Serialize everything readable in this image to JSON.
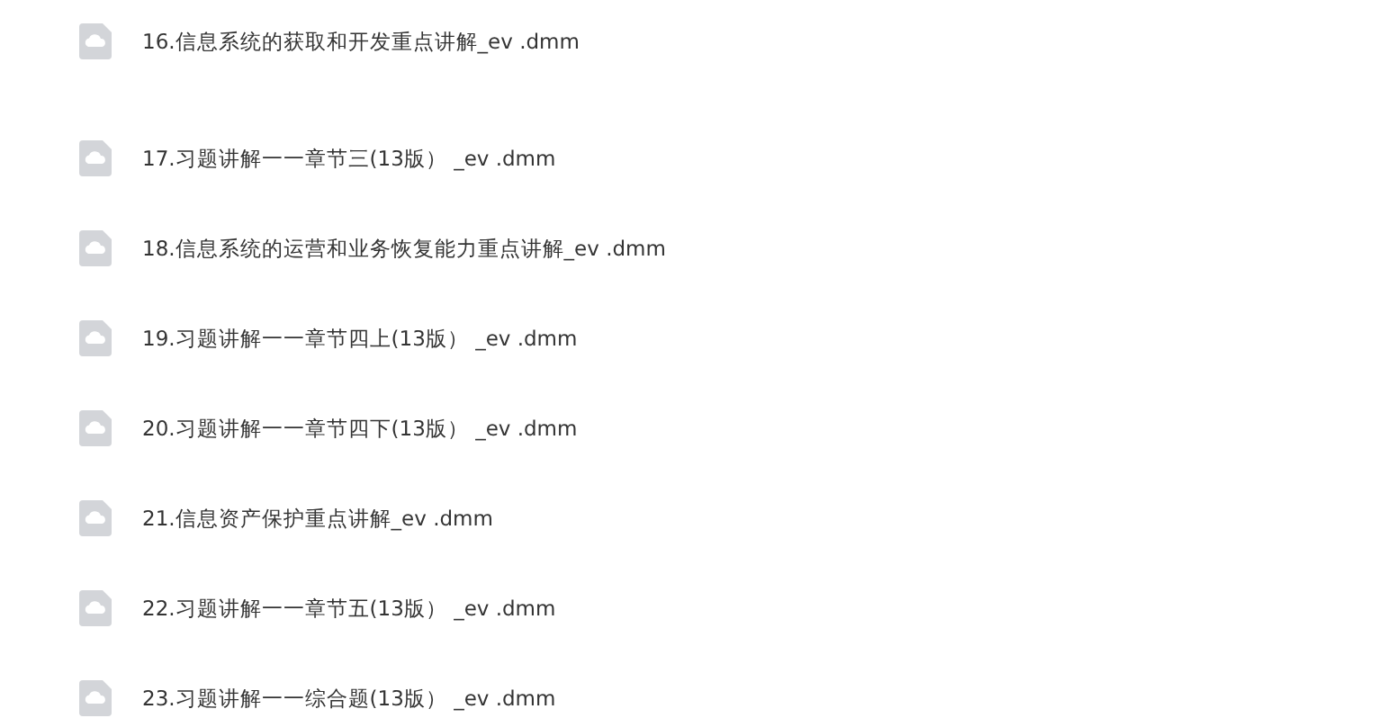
{
  "files": [
    {
      "name": "16.信息系统的获取和开发重点讲解_ev .dmm"
    },
    {
      "name": "17.习题讲解一一章节三(13版） _ev .dmm"
    },
    {
      "name": "18.信息系统的运营和业务恢复能力重点讲解_ev .dmm"
    },
    {
      "name": "19.习题讲解一一章节四上(13版） _ev .dmm"
    },
    {
      "name": "20.习题讲解一一章节四下(13版） _ev .dmm"
    },
    {
      "name": "21.信息资产保护重点讲解_ev .dmm"
    },
    {
      "name": "22.习题讲解一一章节五(13版） _ev .dmm"
    },
    {
      "name": "23.习题讲解一一综合题(13版） _ev .dmm"
    }
  ]
}
